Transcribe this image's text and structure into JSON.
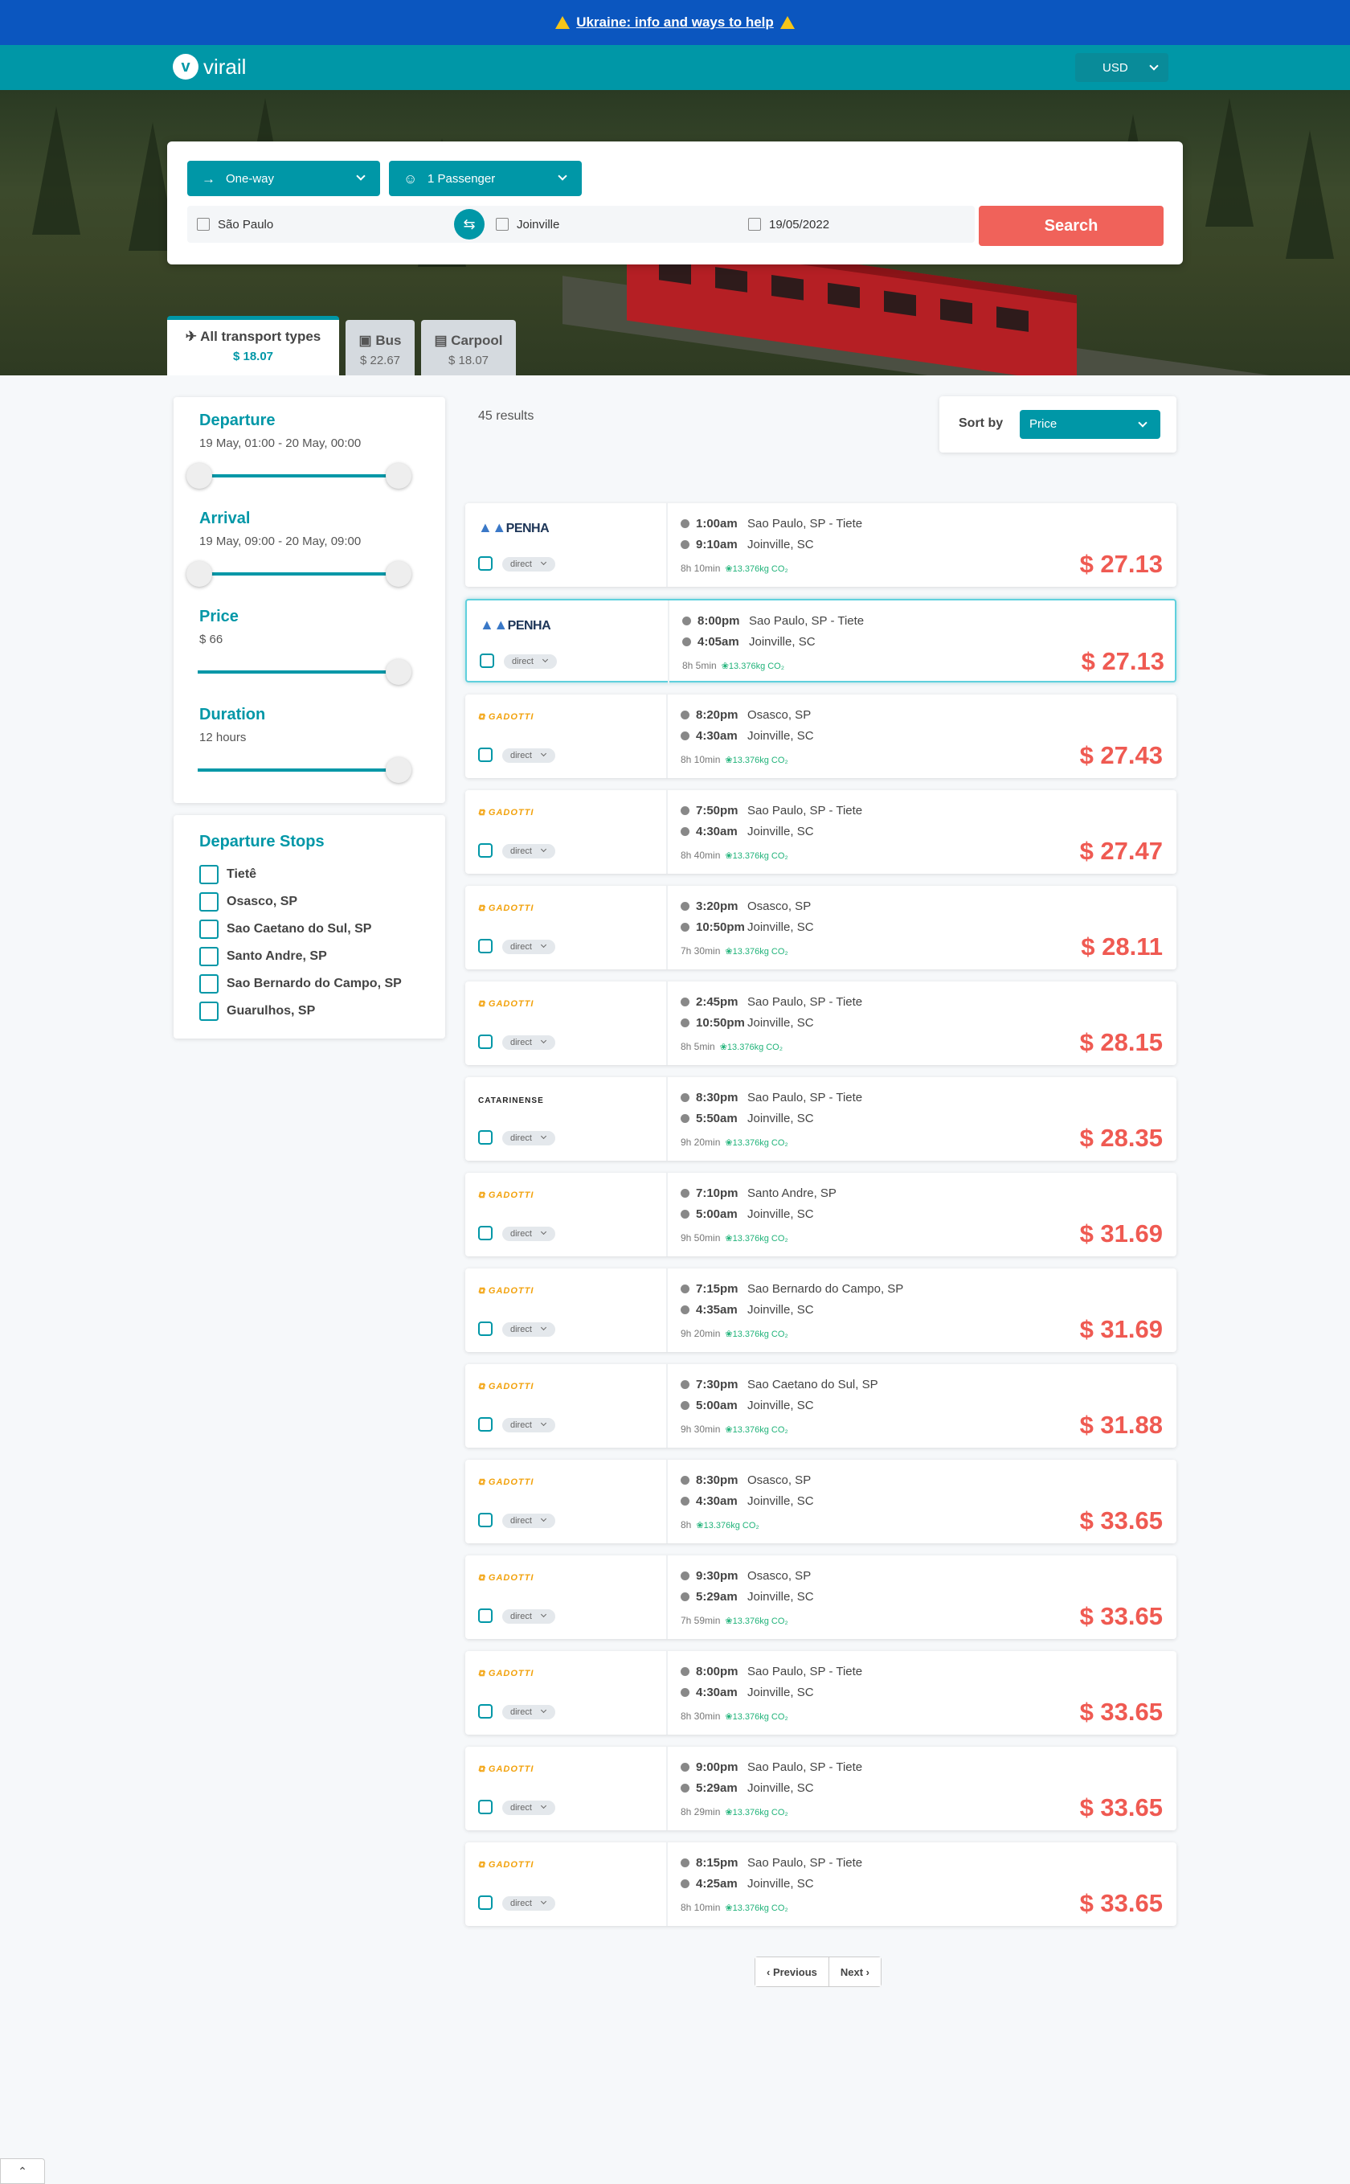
{
  "banner": {
    "text": "Ukraine: info and ways to help"
  },
  "nav": {
    "logo": "virail",
    "logo_mark": "v",
    "currency": "USD"
  },
  "search": {
    "trip_type": "One-way",
    "passengers": "1 Passenger",
    "from": "São Paulo",
    "to": "Joinville",
    "date": "19/05/2022",
    "button": "Search"
  },
  "transport_tabs": [
    {
      "label": "All transport types",
      "price": "$ 18.07"
    },
    {
      "label": "Bus",
      "price": "$ 22.67"
    },
    {
      "label": "Carpool",
      "price": "$ 18.07"
    }
  ],
  "filters": {
    "departure": {
      "title": "Departure",
      "range": "19 May, 01:00 - 20 May, 00:00"
    },
    "arrival": {
      "title": "Arrival",
      "range": "19 May, 09:00 - 20 May, 09:00"
    },
    "price": {
      "title": "Price",
      "value": "$ 66"
    },
    "duration": {
      "title": "Duration",
      "value": "12 hours"
    }
  },
  "departure_stops": {
    "title": "Departure Stops",
    "items": [
      "Tietê",
      "Osasco, SP",
      "Sao Caetano do Sul, SP",
      "Santo Andre, SP",
      "Sao Bernardo do Campo, SP",
      "Guarulhos, SP"
    ]
  },
  "results_count": "45 results",
  "sort": {
    "label": "Sort by",
    "value": "Price"
  },
  "results": [
    {
      "carrier": "PENHA",
      "dep": "1:00am",
      "from": "Sao Paulo, SP - Tiete",
      "arr": "9:10am",
      "to": "Joinville, SC",
      "duration": "8h 10min",
      "co2": "13.376kg CO₂",
      "direct": "direct",
      "price": "$ 27.13"
    },
    {
      "carrier": "PENHA",
      "dep": "8:00pm",
      "from": "Sao Paulo, SP - Tiete",
      "arr": "4:05am",
      "to": "Joinville, SC",
      "duration": "8h 5min",
      "co2": "13.376kg CO₂",
      "direct": "direct",
      "price": "$ 27.13"
    },
    {
      "carrier": "GADOTTI",
      "dep": "8:20pm",
      "from": "Osasco, SP",
      "arr": "4:30am",
      "to": "Joinville, SC",
      "duration": "8h 10min",
      "co2": "13.376kg CO₂",
      "direct": "direct",
      "price": "$ 27.43"
    },
    {
      "carrier": "GADOTTI",
      "dep": "7:50pm",
      "from": "Sao Paulo, SP - Tiete",
      "arr": "4:30am",
      "to": "Joinville, SC",
      "duration": "8h 40min",
      "co2": "13.376kg CO₂",
      "direct": "direct",
      "price": "$ 27.47"
    },
    {
      "carrier": "GADOTTI",
      "dep": "3:20pm",
      "from": "Osasco, SP",
      "arr": "10:50pm",
      "to": "Joinville, SC",
      "duration": "7h 30min",
      "co2": "13.376kg CO₂",
      "direct": "direct",
      "price": "$ 28.11"
    },
    {
      "carrier": "GADOTTI",
      "dep": "2:45pm",
      "from": "Sao Paulo, SP - Tiete",
      "arr": "10:50pm",
      "to": "Joinville, SC",
      "duration": "8h 5min",
      "co2": "13.376kg CO₂",
      "direct": "direct",
      "price": "$ 28.15"
    },
    {
      "carrier": "CATARINENSE",
      "dep": "8:30pm",
      "from": "Sao Paulo, SP - Tiete",
      "arr": "5:50am",
      "to": "Joinville, SC",
      "duration": "9h 20min",
      "co2": "13.376kg CO₂",
      "direct": "direct",
      "price": "$ 28.35"
    },
    {
      "carrier": "GADOTTI",
      "dep": "7:10pm",
      "from": "Santo Andre, SP",
      "arr": "5:00am",
      "to": "Joinville, SC",
      "duration": "9h 50min",
      "co2": "13.376kg CO₂",
      "direct": "direct",
      "price": "$ 31.69"
    },
    {
      "carrier": "GADOTTI",
      "dep": "7:15pm",
      "from": "Sao Bernardo do Campo, SP",
      "arr": "4:35am",
      "to": "Joinville, SC",
      "duration": "9h 20min",
      "co2": "13.376kg CO₂",
      "direct": "direct",
      "price": "$ 31.69"
    },
    {
      "carrier": "GADOTTI",
      "dep": "7:30pm",
      "from": "Sao Caetano do Sul, SP",
      "arr": "5:00am",
      "to": "Joinville, SC",
      "duration": "9h 30min",
      "co2": "13.376kg CO₂",
      "direct": "direct",
      "price": "$ 31.88"
    },
    {
      "carrier": "GADOTTI",
      "dep": "8:30pm",
      "from": "Osasco, SP",
      "arr": "4:30am",
      "to": "Joinville, SC",
      "duration": "8h",
      "co2": "13.376kg CO₂",
      "direct": "direct",
      "price": "$ 33.65"
    },
    {
      "carrier": "GADOTTI",
      "dep": "9:30pm",
      "from": "Osasco, SP",
      "arr": "5:29am",
      "to": "Joinville, SC",
      "duration": "7h 59min",
      "co2": "13.376kg CO₂",
      "direct": "direct",
      "price": "$ 33.65"
    },
    {
      "carrier": "GADOTTI",
      "dep": "8:00pm",
      "from": "Sao Paulo, SP - Tiete",
      "arr": "4:30am",
      "to": "Joinville, SC",
      "duration": "8h 30min",
      "co2": "13.376kg CO₂",
      "direct": "direct",
      "price": "$ 33.65"
    },
    {
      "carrier": "GADOTTI",
      "dep": "9:00pm",
      "from": "Sao Paulo, SP - Tiete",
      "arr": "5:29am",
      "to": "Joinville, SC",
      "duration": "8h 29min",
      "co2": "13.376kg CO₂",
      "direct": "direct",
      "price": "$ 33.65"
    },
    {
      "carrier": "GADOTTI",
      "dep": "8:15pm",
      "from": "Sao Paulo, SP - Tiete",
      "arr": "4:25am",
      "to": "Joinville, SC",
      "duration": "8h 10min",
      "co2": "13.376kg CO₂",
      "direct": "direct",
      "price": "$ 33.65"
    }
  ],
  "pager": {
    "previous": "Previous",
    "next": "Next"
  },
  "icons": {
    "warning": "warning-icon",
    "swap": "swap-icon",
    "calendar": "calendar-icon",
    "bus": "bus-icon",
    "car": "car-icon",
    "plane": "plane-icon"
  },
  "colors": {
    "brand": "#0097a7",
    "banner": "#0b56bf",
    "price": "#ef5a52",
    "search_button": "#f0625a"
  }
}
